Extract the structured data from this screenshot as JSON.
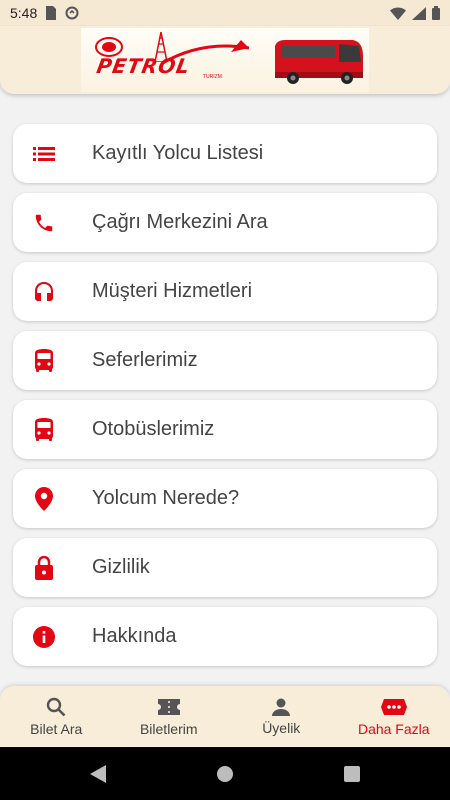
{
  "status_bar": {
    "time": "5:48"
  },
  "header": {
    "logo_text": "PETROL",
    "logo_sub": "TURİZM"
  },
  "menu": {
    "items": [
      {
        "label": "Kayıtlı Yolcu Listesi",
        "icon": "list-icon"
      },
      {
        "label": "Çağrı Merkezini Ara",
        "icon": "phone-icon"
      },
      {
        "label": "Müşteri Hizmetleri",
        "icon": "headset-icon"
      },
      {
        "label": "Seferlerimiz",
        "icon": "bus-icon"
      },
      {
        "label": "Otobüslerimiz",
        "icon": "bus-icon"
      },
      {
        "label": "Yolcum Nerede?",
        "icon": "location-pin-icon"
      },
      {
        "label": "Gizlilik",
        "icon": "lock-icon"
      },
      {
        "label": "Hakkında",
        "icon": "info-icon"
      }
    ]
  },
  "bottom_nav": {
    "items": [
      {
        "label": "Bilet Ara",
        "icon": "search-icon"
      },
      {
        "label": "Biletlerim",
        "icon": "ticket-icon"
      },
      {
        "label": "Üyelik",
        "icon": "person-icon"
      },
      {
        "label": "Daha Fazla",
        "icon": "more-icon",
        "active": true
      }
    ]
  },
  "colors": {
    "accent": "#e30613",
    "header_bg": "#f7edd9",
    "text": "#444444"
  }
}
